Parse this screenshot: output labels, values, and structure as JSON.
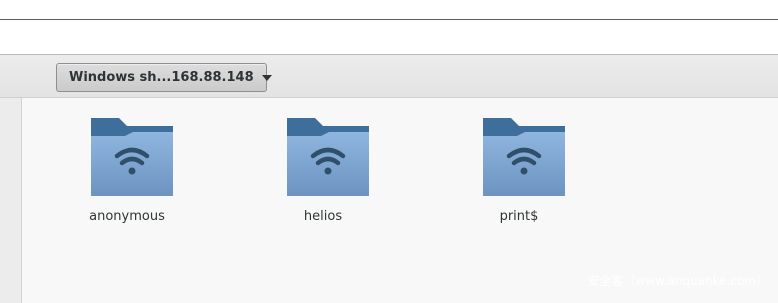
{
  "toolbar": {
    "location_label": "Windows sh...168.88.148"
  },
  "folders": [
    {
      "label": "anonymous",
      "icon": "network-share-folder-icon"
    },
    {
      "label": "helios",
      "icon": "network-share-folder-icon"
    },
    {
      "label": "print$",
      "icon": "network-share-folder-icon"
    }
  ],
  "watermark": "安全客（www.anquanke.com）",
  "colors": {
    "folder_back": "#3e6f9c",
    "folder_front_top": "#8fb6df",
    "folder_front_bottom": "#6d93c1",
    "wifi_glyph": "#2f4f6b"
  }
}
